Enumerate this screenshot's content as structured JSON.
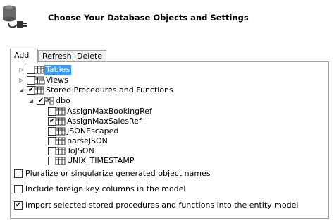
{
  "header": {
    "title": "Choose Your Database Objects and Settings",
    "icon": "database-plug-icon"
  },
  "tabs": [
    {
      "label": "Add",
      "active": true
    },
    {
      "label": "Refresh",
      "active": false
    },
    {
      "label": "Delete",
      "active": false
    }
  ],
  "tree": {
    "tables": {
      "label": "Tables",
      "checked": false,
      "expanded": false,
      "selected": true
    },
    "views": {
      "label": "Views",
      "checked": false,
      "expanded": false
    },
    "procs": {
      "label": "Stored Procedures and Functions",
      "checked": true,
      "expanded": true
    },
    "dbo": {
      "label": "dbo",
      "checked": true,
      "expanded": true
    },
    "items": [
      {
        "label": "AssignMaxBookingRef",
        "checked": false
      },
      {
        "label": "AssignMaxSalesRef",
        "checked": true
      },
      {
        "label": "JSONEscaped",
        "checked": false
      },
      {
        "label": "parseJSON",
        "checked": false
      },
      {
        "label": "ToJSON",
        "checked": false
      },
      {
        "label": "UNIX_TIMESTAMP",
        "checked": false
      }
    ]
  },
  "options": [
    {
      "label": "Pluralize or singularize generated object names",
      "checked": false
    },
    {
      "label": "Include foreign key columns in the model",
      "checked": false
    },
    {
      "label": "Import selected stored procedures and functions into the entity model",
      "checked": true
    }
  ]
}
